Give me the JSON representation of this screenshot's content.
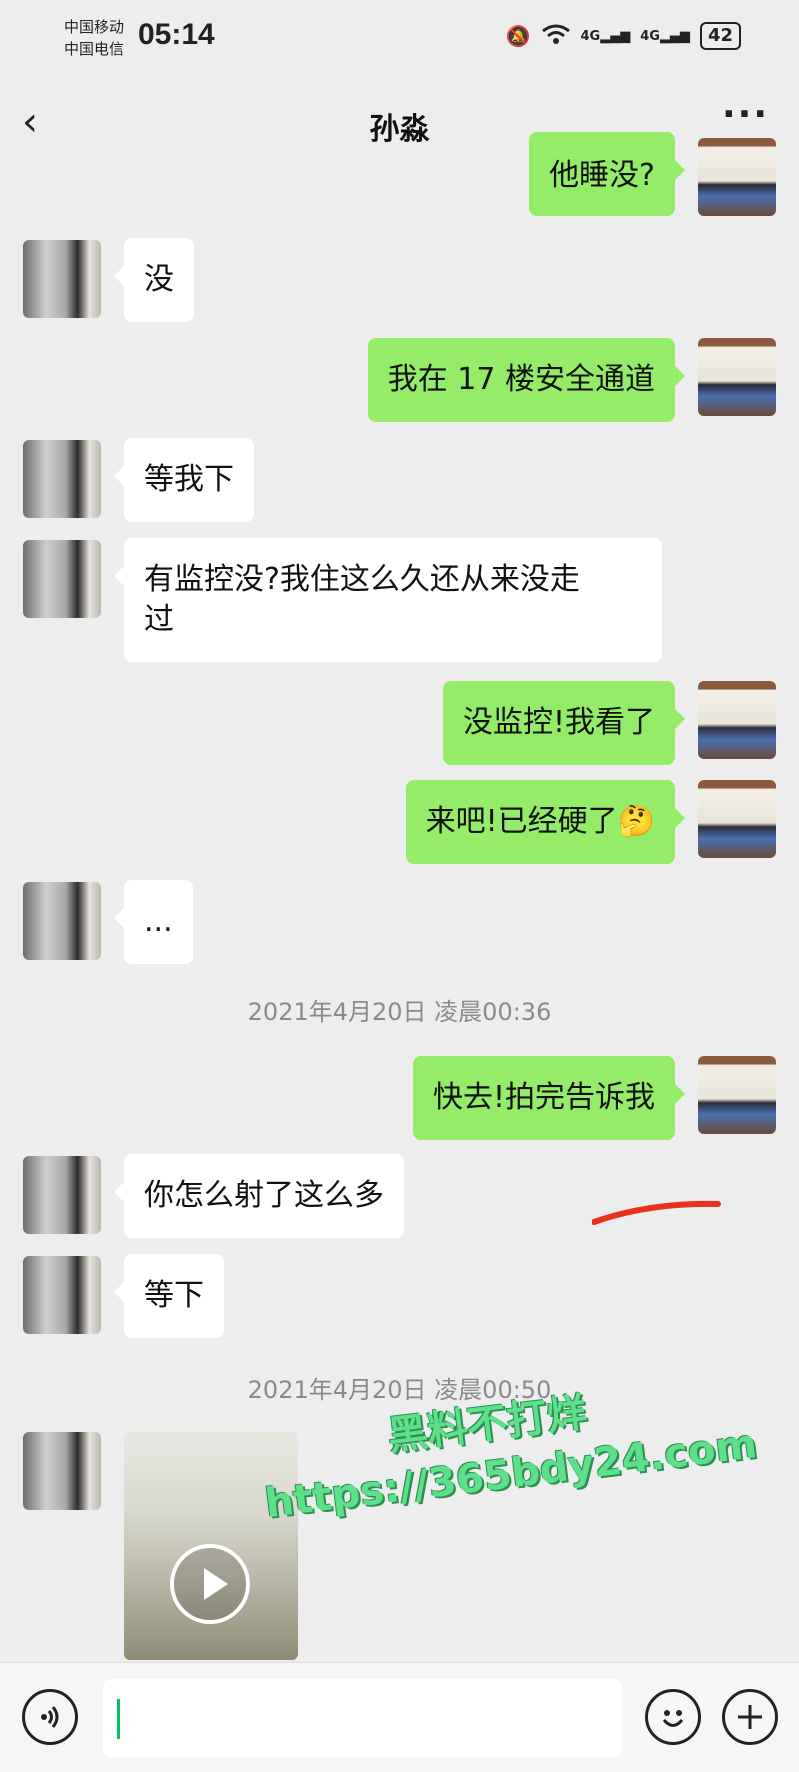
{
  "status_bar": {
    "carrier_1": "中国移动",
    "carrier_2": "中国电信",
    "time": "05:14",
    "network_1": "4G",
    "network_2": "4G",
    "battery": "42"
  },
  "header": {
    "title": "孙淼"
  },
  "messages": [
    {
      "side": "out",
      "text": "他睡没?"
    },
    {
      "side": "in",
      "text": "没"
    },
    {
      "side": "out",
      "text": "我在 17 楼安全通道"
    },
    {
      "side": "in",
      "text": "等我下"
    },
    {
      "side": "in",
      "text_line1": "有监控没?我住这么久还从来没走",
      "text_line2": "过"
    },
    {
      "side": "out",
      "text": "没监控!我看了"
    },
    {
      "side": "out",
      "text": "来吧!已经硬了",
      "emoji": "🤔"
    },
    {
      "side": "in",
      "text": "..."
    },
    {
      "side": "out",
      "text": "快去!拍完告诉我"
    },
    {
      "side": "in",
      "text": "你怎么射了这么多"
    },
    {
      "side": "in",
      "text": "等下"
    }
  ],
  "timestamps": [
    "2021年4月20日 凌晨00:36",
    "2021年4月20日 凌晨00:50"
  ],
  "watermark": {
    "line1": "黑料不打烊",
    "line2": "https://365bdy24.com"
  },
  "colors": {
    "outgoing_bubble": "#95ec69",
    "incoming_bubble": "#ffffff",
    "background": "#ededed",
    "annotation": "#e8321e"
  }
}
